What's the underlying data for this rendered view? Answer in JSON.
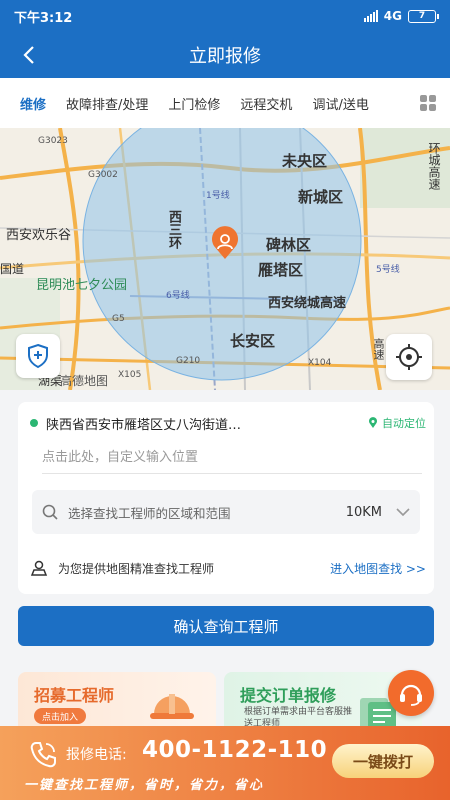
{
  "status_bar": {
    "time": "下午3:12",
    "network": "4G",
    "battery": "7"
  },
  "header": {
    "title": "立即报修"
  },
  "tabs": [
    "维修",
    "故障排查/处理",
    "上门检修",
    "远程交机",
    "调试/送电"
  ],
  "map": {
    "labels": {
      "weiyangqu": "未央区",
      "xinchengqu": "新城区",
      "beilinqu": "碑林区",
      "yantaqu": "雁塔区",
      "changanqu": "长安区",
      "huanghuang": "西安绕城高速",
      "kunming": "昆明池七夕公园",
      "xian_happy": "西安欢乐谷",
      "xisan": "西三环",
      "line1": "1号线",
      "line5": "5号线",
      "line6": "6号线",
      "g3002": "G3002",
      "g3023": "G3023",
      "g5": "G5",
      "g210": "G210",
      "x105": "X105",
      "x104": "X104",
      "guodao": "国道",
      "gaosu": "高速",
      "huanhuan": "环城高速",
      "huanhu": "湖渠",
      "watermark": "高德地图"
    }
  },
  "location_card": {
    "address": "陕西省西安市雁塔区丈八沟街道…",
    "auto_locate": "自动定位",
    "custom_placeholder": "点击此处，自定义输入位置",
    "search_placeholder": "选择查找工程师的区域和范围",
    "range": "10KM",
    "map_hint": "为您提供地图精准查找工程师",
    "map_link": "进入地图查找 >>"
  },
  "confirm_button": "确认查询工程师",
  "promos": {
    "recruit": {
      "title": "招募工程师",
      "button": "点击加入"
    },
    "submit": {
      "title": "提交订单报修",
      "subtitle": "根据订单需求由平台客服推送工程师"
    }
  },
  "footer": {
    "tel_label": "报修电话:",
    "tel_number": "400-1122-110",
    "slogan": "一键查找工程师，省时，省力，省心",
    "call_button": "一键拨打"
  },
  "colors": {
    "primary": "#1c6fc4",
    "accent": "#f26b2c",
    "green": "#2bb673"
  }
}
